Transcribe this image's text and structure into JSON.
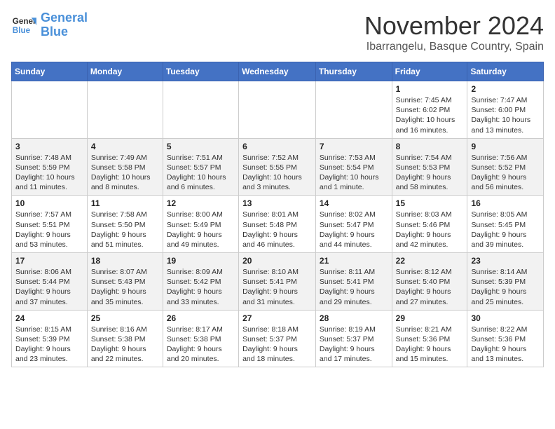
{
  "logo": {
    "line1": "General",
    "line2": "Blue"
  },
  "title": "November 2024",
  "location": "Ibarrangelu, Basque Country, Spain",
  "days_of_week": [
    "Sunday",
    "Monday",
    "Tuesday",
    "Wednesday",
    "Thursday",
    "Friday",
    "Saturday"
  ],
  "weeks": [
    [
      {
        "day": "",
        "info": ""
      },
      {
        "day": "",
        "info": ""
      },
      {
        "day": "",
        "info": ""
      },
      {
        "day": "",
        "info": ""
      },
      {
        "day": "",
        "info": ""
      },
      {
        "day": "1",
        "info": "Sunrise: 7:45 AM\nSunset: 6:02 PM\nDaylight: 10 hours and 16 minutes."
      },
      {
        "day": "2",
        "info": "Sunrise: 7:47 AM\nSunset: 6:00 PM\nDaylight: 10 hours and 13 minutes."
      }
    ],
    [
      {
        "day": "3",
        "info": "Sunrise: 7:48 AM\nSunset: 5:59 PM\nDaylight: 10 hours and 11 minutes."
      },
      {
        "day": "4",
        "info": "Sunrise: 7:49 AM\nSunset: 5:58 PM\nDaylight: 10 hours and 8 minutes."
      },
      {
        "day": "5",
        "info": "Sunrise: 7:51 AM\nSunset: 5:57 PM\nDaylight: 10 hours and 6 minutes."
      },
      {
        "day": "6",
        "info": "Sunrise: 7:52 AM\nSunset: 5:55 PM\nDaylight: 10 hours and 3 minutes."
      },
      {
        "day": "7",
        "info": "Sunrise: 7:53 AM\nSunset: 5:54 PM\nDaylight: 10 hours and 1 minute."
      },
      {
        "day": "8",
        "info": "Sunrise: 7:54 AM\nSunset: 5:53 PM\nDaylight: 9 hours and 58 minutes."
      },
      {
        "day": "9",
        "info": "Sunrise: 7:56 AM\nSunset: 5:52 PM\nDaylight: 9 hours and 56 minutes."
      }
    ],
    [
      {
        "day": "10",
        "info": "Sunrise: 7:57 AM\nSunset: 5:51 PM\nDaylight: 9 hours and 53 minutes."
      },
      {
        "day": "11",
        "info": "Sunrise: 7:58 AM\nSunset: 5:50 PM\nDaylight: 9 hours and 51 minutes."
      },
      {
        "day": "12",
        "info": "Sunrise: 8:00 AM\nSunset: 5:49 PM\nDaylight: 9 hours and 49 minutes."
      },
      {
        "day": "13",
        "info": "Sunrise: 8:01 AM\nSunset: 5:48 PM\nDaylight: 9 hours and 46 minutes."
      },
      {
        "day": "14",
        "info": "Sunrise: 8:02 AM\nSunset: 5:47 PM\nDaylight: 9 hours and 44 minutes."
      },
      {
        "day": "15",
        "info": "Sunrise: 8:03 AM\nSunset: 5:46 PM\nDaylight: 9 hours and 42 minutes."
      },
      {
        "day": "16",
        "info": "Sunrise: 8:05 AM\nSunset: 5:45 PM\nDaylight: 9 hours and 39 minutes."
      }
    ],
    [
      {
        "day": "17",
        "info": "Sunrise: 8:06 AM\nSunset: 5:44 PM\nDaylight: 9 hours and 37 minutes."
      },
      {
        "day": "18",
        "info": "Sunrise: 8:07 AM\nSunset: 5:43 PM\nDaylight: 9 hours and 35 minutes."
      },
      {
        "day": "19",
        "info": "Sunrise: 8:09 AM\nSunset: 5:42 PM\nDaylight: 9 hours and 33 minutes."
      },
      {
        "day": "20",
        "info": "Sunrise: 8:10 AM\nSunset: 5:41 PM\nDaylight: 9 hours and 31 minutes."
      },
      {
        "day": "21",
        "info": "Sunrise: 8:11 AM\nSunset: 5:41 PM\nDaylight: 9 hours and 29 minutes."
      },
      {
        "day": "22",
        "info": "Sunrise: 8:12 AM\nSunset: 5:40 PM\nDaylight: 9 hours and 27 minutes."
      },
      {
        "day": "23",
        "info": "Sunrise: 8:14 AM\nSunset: 5:39 PM\nDaylight: 9 hours and 25 minutes."
      }
    ],
    [
      {
        "day": "24",
        "info": "Sunrise: 8:15 AM\nSunset: 5:39 PM\nDaylight: 9 hours and 23 minutes."
      },
      {
        "day": "25",
        "info": "Sunrise: 8:16 AM\nSunset: 5:38 PM\nDaylight: 9 hours and 22 minutes."
      },
      {
        "day": "26",
        "info": "Sunrise: 8:17 AM\nSunset: 5:38 PM\nDaylight: 9 hours and 20 minutes."
      },
      {
        "day": "27",
        "info": "Sunrise: 8:18 AM\nSunset: 5:37 PM\nDaylight: 9 hours and 18 minutes."
      },
      {
        "day": "28",
        "info": "Sunrise: 8:19 AM\nSunset: 5:37 PM\nDaylight: 9 hours and 17 minutes."
      },
      {
        "day": "29",
        "info": "Sunrise: 8:21 AM\nSunset: 5:36 PM\nDaylight: 9 hours and 15 minutes."
      },
      {
        "day": "30",
        "info": "Sunrise: 8:22 AM\nSunset: 5:36 PM\nDaylight: 9 hours and 13 minutes."
      }
    ]
  ]
}
